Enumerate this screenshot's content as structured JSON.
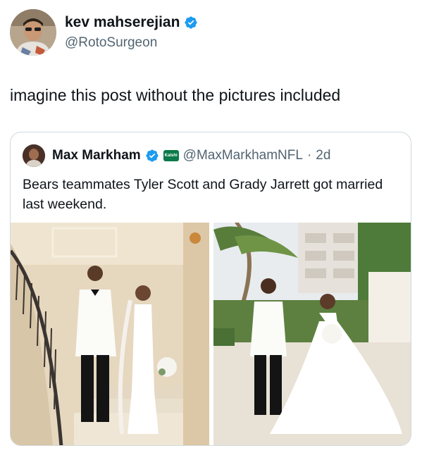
{
  "author": {
    "display_name": "kev mahserejian",
    "handle": "@RotoSurgeon",
    "verified_icon": "verified-badge-icon"
  },
  "post": {
    "text": "imagine this post without the pictures included"
  },
  "quoted_post": {
    "display_name": "Max Markham",
    "affiliate_badge_text": "Kalshi",
    "handle": "@MaxMarkhamNFL",
    "separator": "·",
    "time": "2d",
    "text": "Bears teammates Tyler Scott and Grady Jarrett got married last weekend.",
    "images": [
      "wedding-photo-staircase",
      "wedding-photo-garden"
    ]
  },
  "colors": {
    "verified_blue": "#1d9bf0",
    "secondary_text": "#536471",
    "border": "#cfd9de",
    "kalshi_green": "#0c7a4a"
  }
}
